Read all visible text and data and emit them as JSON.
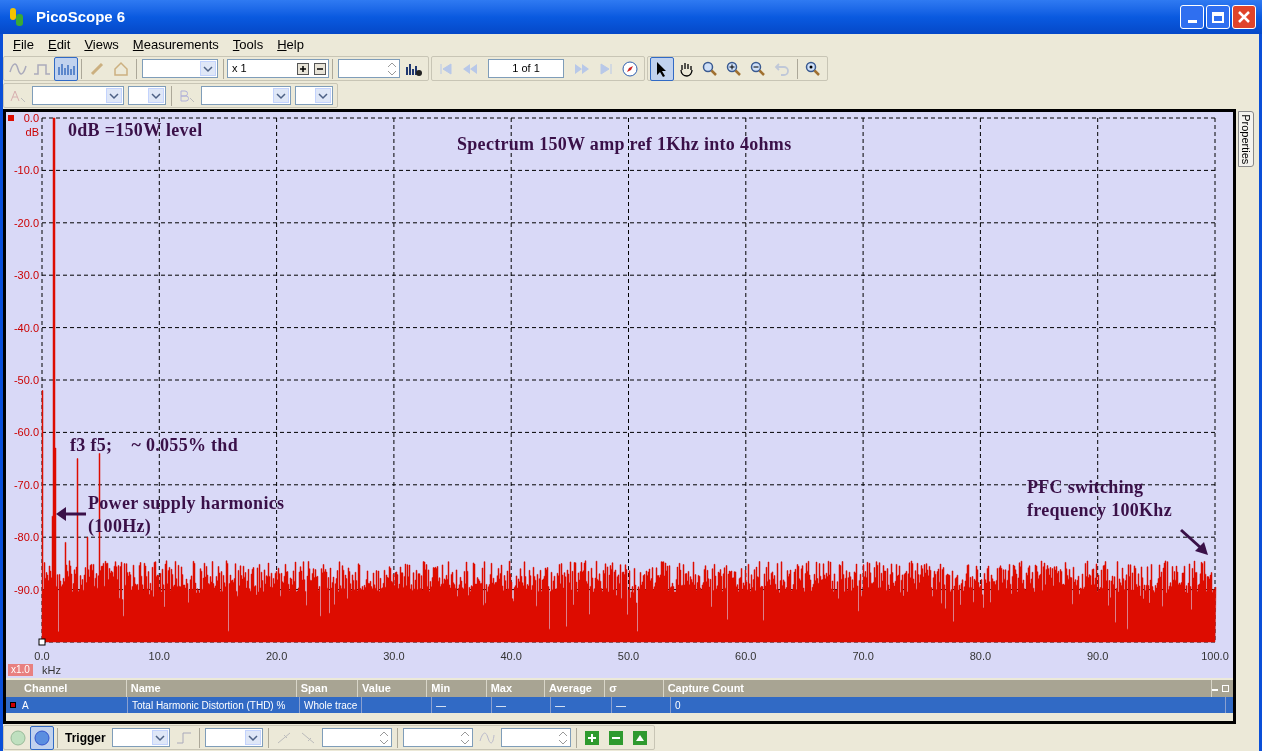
{
  "window": {
    "title": "PicoScope 6"
  },
  "menu": [
    {
      "label": "File"
    },
    {
      "label": "Edit"
    },
    {
      "label": "Views"
    },
    {
      "label": "Measurements"
    },
    {
      "label": "Tools"
    },
    {
      "label": "Help"
    }
  ],
  "toolbar": {
    "zoom_factor": "x 1",
    "page": "1 of 1"
  },
  "side_tab": "Properties",
  "plot": {
    "y_unit": "dB",
    "x_unit": "kHz",
    "x_scale": "x1.0",
    "y_ticks": [
      "0.0",
      "-10.0",
      "-20.0",
      "-30.0",
      "-40.0",
      "-50.0",
      "-60.0",
      "-70.0",
      "-80.0",
      "-90.0"
    ],
    "x_ticks": [
      "0.0",
      "10.0",
      "20.0",
      "30.0",
      "40.0",
      "50.0",
      "60.0",
      "70.0",
      "80.0",
      "90.0",
      "100.0"
    ],
    "annotations": [
      {
        "text": "0dB =150W level",
        "kind": "label"
      },
      {
        "text": "Spectrum 150W amp ref 1Khz into 4ohms",
        "kind": "label"
      },
      {
        "text": "f3 f5;    ~ 0.055% thd",
        "kind": "label"
      },
      {
        "text": "Power supply harmonics\n(100Hz)",
        "kind": "leftarrow"
      },
      {
        "text": "PFC switching\nfrequency 100Khz",
        "kind": "downarrow"
      }
    ]
  },
  "measurements": {
    "columns": [
      "Channel",
      "Name",
      "Span",
      "Value",
      "Min",
      "Max",
      "Average",
      "σ",
      "Capture Count"
    ],
    "rows": [
      {
        "selected": true,
        "color": "#cc0000",
        "cells": [
          "A",
          "Total Harmonic Distortion (THD) %",
          "Whole trace",
          "",
          "—",
          "—",
          "—",
          "—",
          "0"
        ]
      }
    ]
  },
  "bottom_toolbar": {
    "trigger_label": "Trigger"
  }
}
